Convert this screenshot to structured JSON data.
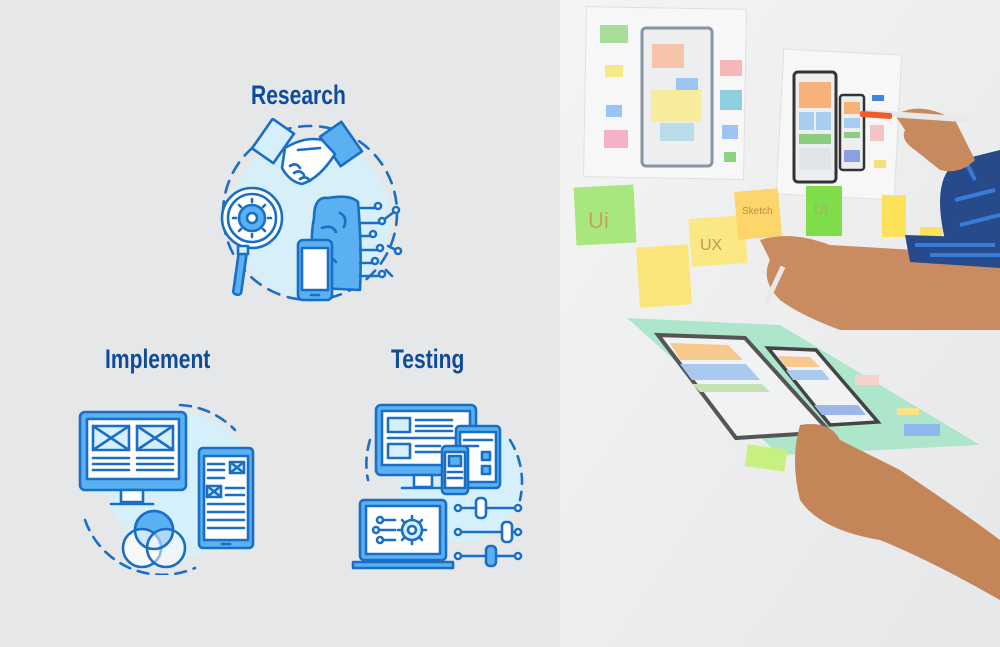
{
  "sections": [
    {
      "id": "research",
      "title": "Research",
      "icon": "research-handshake-brain-icon"
    },
    {
      "id": "implement",
      "title": "Implement",
      "icon": "implement-wireframe-devices-icon"
    },
    {
      "id": "testing",
      "title": "Testing",
      "icon": "testing-devices-settings-icon"
    }
  ],
  "photo": {
    "description": "hands arranging UX wireframes and sticky notes on a wall",
    "sticky_notes": [
      "Ui",
      "UX",
      "Sketch",
      "UI"
    ]
  },
  "colors": {
    "background": "#e6e7e9",
    "title": "#0e4c9a",
    "icon_stroke": "#1a6fc4",
    "icon_fill_light": "#d5f0fb",
    "icon_fill_mid": "#5ab0f0"
  }
}
